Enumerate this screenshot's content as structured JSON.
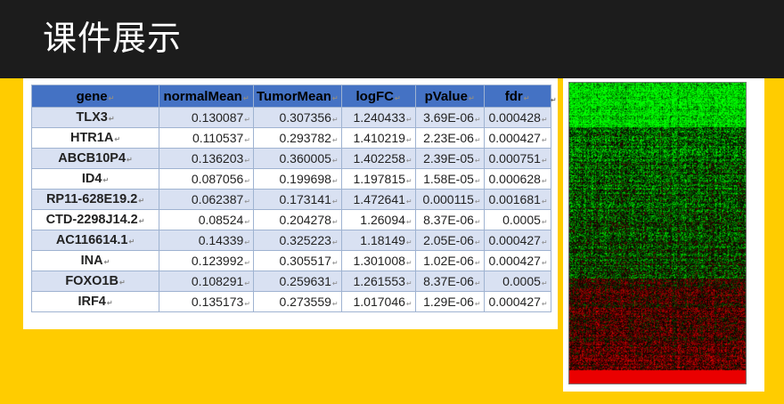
{
  "header": {
    "title": "课件展示"
  },
  "table": {
    "columns": [
      "gene",
      "normalMean",
      "TumorMean",
      "logFC",
      "pValue",
      "fdr"
    ],
    "rows": [
      [
        "TLX3",
        "0.130087",
        "0.307356",
        "1.240433",
        "3.69E-06",
        "0.000428"
      ],
      [
        "HTR1A",
        "0.110537",
        "0.293782",
        "1.410219",
        "2.23E-06",
        "0.000427"
      ],
      [
        "ABCB10P4",
        "0.136203",
        "0.360005",
        "1.402258",
        "2.39E-05",
        "0.000751"
      ],
      [
        "ID4",
        "0.087056",
        "0.199698",
        "1.197815",
        "1.58E-05",
        "0.000628"
      ],
      [
        "RP11-628E19.2",
        "0.062387",
        "0.173141",
        "1.472641",
        "0.000115",
        "0.001681"
      ],
      [
        "CTD-2298J14.2",
        "0.08524",
        "0.204278",
        "1.26094",
        "8.37E-06",
        "0.0005"
      ],
      [
        "AC116614.1",
        "0.14339",
        "0.325223",
        "1.18149",
        "2.05E-06",
        "0.000427"
      ],
      [
        "INA",
        "0.123992",
        "0.305517",
        "1.301008",
        "1.02E-06",
        "0.000427"
      ],
      [
        "FOXO1B",
        "0.108291",
        "0.259631",
        "1.261553",
        "8.37E-06",
        "0.0005"
      ],
      [
        "IRF4",
        "0.135173",
        "0.273559",
        "1.017046",
        "1.29E-06",
        "0.000427"
      ]
    ]
  },
  "heatmap": {
    "colors": {
      "high": "#ff2a1a",
      "mid": "#000000",
      "low": "#22ff22"
    }
  }
}
